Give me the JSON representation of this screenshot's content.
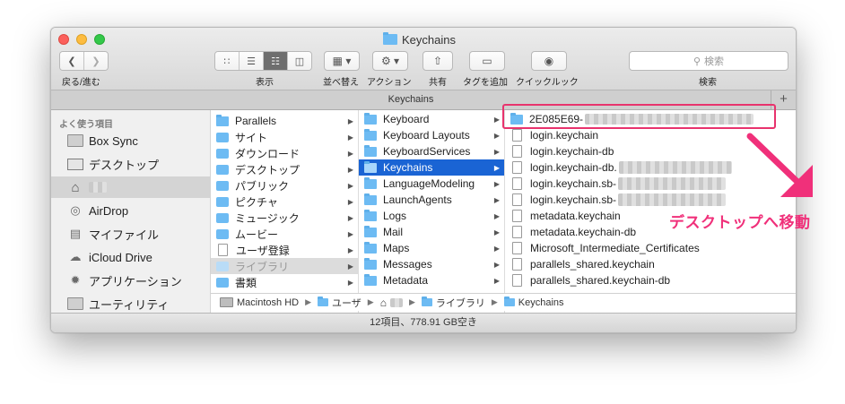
{
  "window": {
    "title": "Keychains",
    "tab_title": "Keychains",
    "tab_plus": "+"
  },
  "toolbar": {
    "back_label": "戻る/進む",
    "view_label": "表示",
    "arrange_label": "並べ替え",
    "action_label": "アクション",
    "share_label": "共有",
    "tag_label": "タグを追加",
    "quicklook_label": "クイックルック",
    "search_label": "検索",
    "search_placeholder": "検索"
  },
  "sidebar": {
    "heading": "よく使う項目",
    "items": [
      {
        "label": "Box Sync",
        "icon": "folder-icon"
      },
      {
        "label": "デスクトップ",
        "icon": "desktop-icon"
      },
      {
        "label": "",
        "icon": "home-icon"
      },
      {
        "label": "AirDrop",
        "icon": "airdrop-icon"
      },
      {
        "label": "マイファイル",
        "icon": "all-files-icon"
      },
      {
        "label": "iCloud Drive",
        "icon": "cloud-icon"
      },
      {
        "label": "アプリケーション",
        "icon": "applications-icon"
      },
      {
        "label": "ユーティリティ",
        "icon": "folder-icon"
      }
    ]
  },
  "column1": [
    {
      "label": "Parallels"
    },
    {
      "label": "サイト"
    },
    {
      "label": "ダウンロード"
    },
    {
      "label": "デスクトップ"
    },
    {
      "label": "パブリック"
    },
    {
      "label": "ピクチャ"
    },
    {
      "label": "ミュージック"
    },
    {
      "label": "ムービー"
    },
    {
      "label": "ユーザ登録"
    },
    {
      "label": "ライブラリ"
    },
    {
      "label": "書類"
    }
  ],
  "column2": [
    {
      "label": "Keyboard"
    },
    {
      "label": "Keyboard Layouts"
    },
    {
      "label": "KeyboardServices"
    },
    {
      "label": "Keychains"
    },
    {
      "label": "LanguageModeling"
    },
    {
      "label": "LaunchAgents"
    },
    {
      "label": "Logs"
    },
    {
      "label": "Mail"
    },
    {
      "label": "Maps"
    },
    {
      "label": "Messages"
    },
    {
      "label": "Metadata"
    }
  ],
  "column3": [
    {
      "label": "2E085E69-"
    },
    {
      "label": "login.keychain"
    },
    {
      "label": "login.keychain-db"
    },
    {
      "label": "login.keychain-db."
    },
    {
      "label": "login.keychain.sb-"
    },
    {
      "label": "login.keychain.sb-"
    },
    {
      "label": "metadata.keychain"
    },
    {
      "label": "metadata.keychain-db"
    },
    {
      "label": "Microsoft_Intermediate_Certificates"
    },
    {
      "label": "parallels_shared.keychain"
    },
    {
      "label": "parallels_shared.keychain-db"
    }
  ],
  "pathbar": {
    "items": [
      "Macintosh HD",
      "ユーザ",
      "",
      "ライブラリ",
      "Keychains"
    ]
  },
  "status": "12項目、778.91 GB空き",
  "annotation": {
    "callout": "デスクトップへ移動",
    "color": "#f0307a"
  },
  "colors": {
    "selection": "#1a64d4",
    "folder": "#6dbbf3",
    "close": "#fc605c",
    "minimize": "#fdbc40",
    "maximize": "#34c84a"
  }
}
